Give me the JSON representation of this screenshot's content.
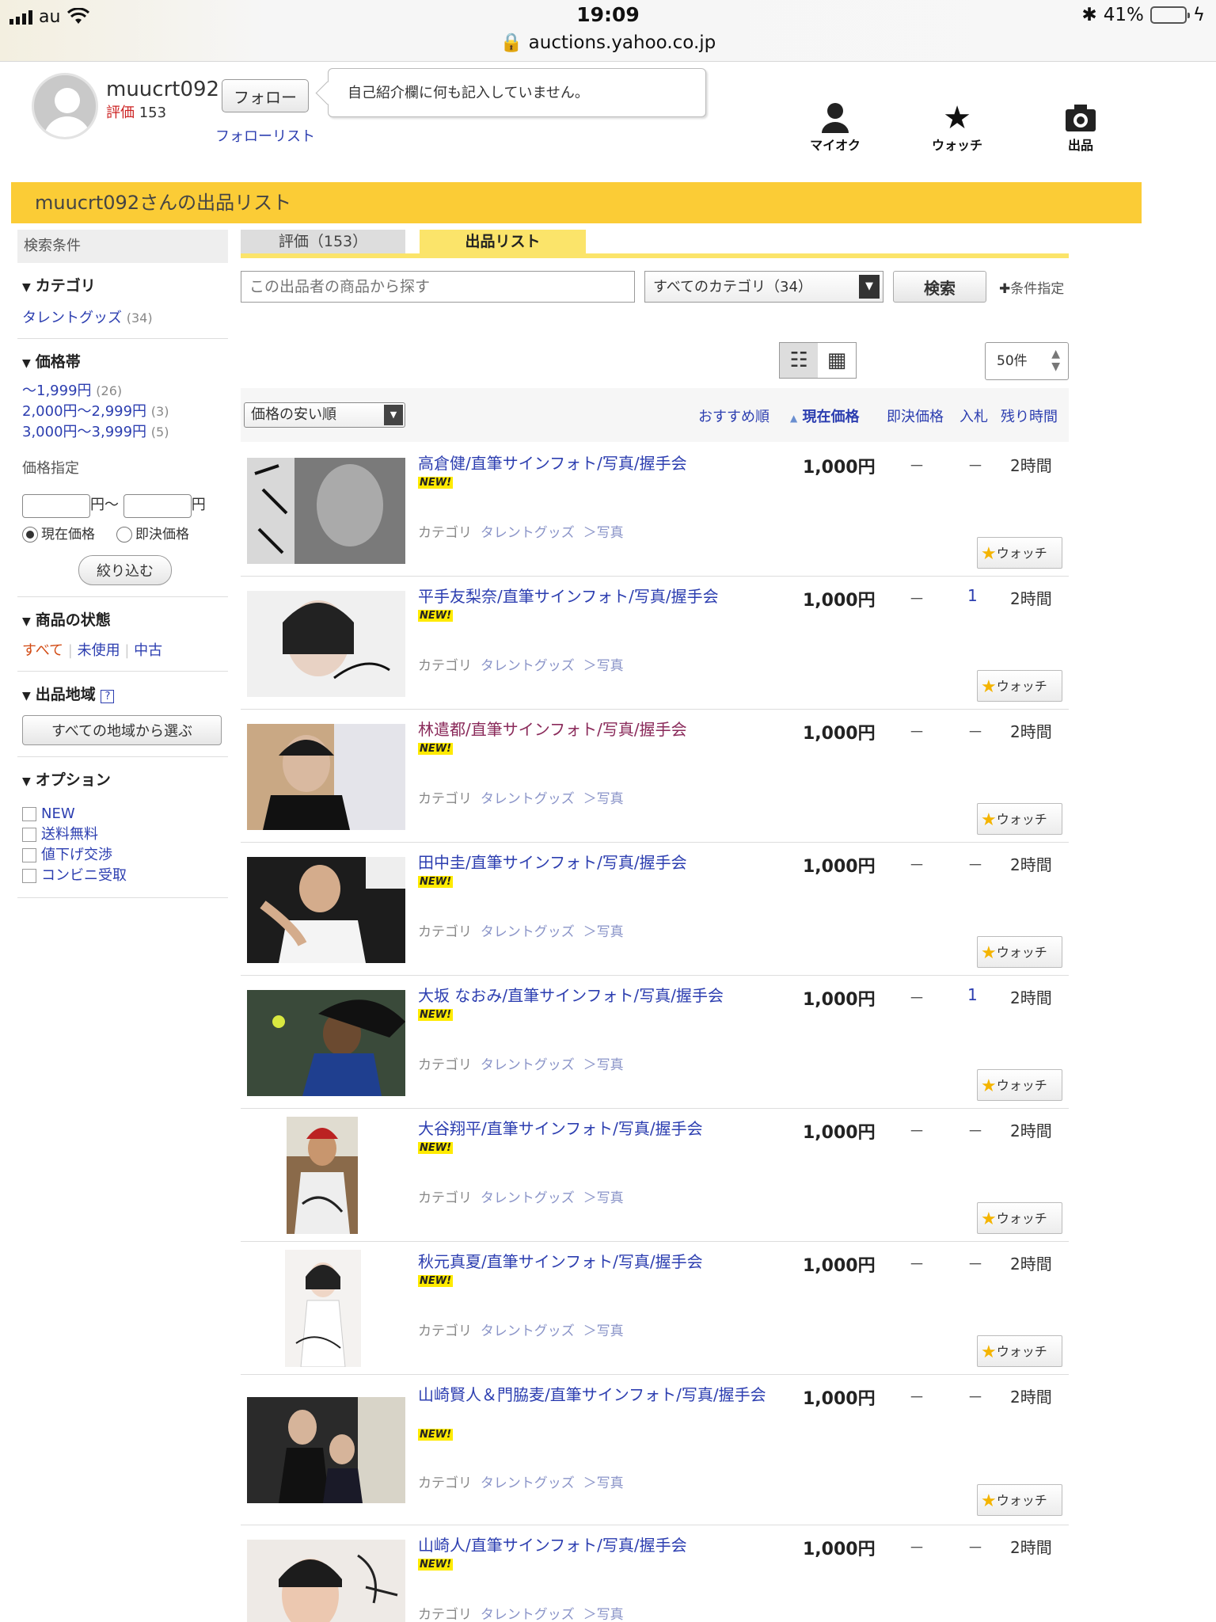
{
  "status": {
    "carrier": "au",
    "time": "19:09",
    "url": "auctions.yahoo.co.jp",
    "battery": "41%",
    "battery_level": 0.41
  },
  "profile": {
    "username": "muucrt092",
    "rating_label": "評価",
    "rating_value": "153",
    "follow_button": "フォロー",
    "follow_list": "フォローリスト",
    "intro": "自己紹介欄に何も記入していません。"
  },
  "topnav": {
    "myauc": "マイオク",
    "watch": "ウォッチ",
    "sell": "出品"
  },
  "page_title": "muucrt092さんの出品リスト",
  "sidebar": {
    "conditions": "検索条件",
    "category_head": "カテゴリ",
    "category_item": "タレントグッズ",
    "category_count": "(34)",
    "price_head": "価格帯",
    "price_ranges": [
      {
        "label": "～1,999円",
        "count": "(26)"
      },
      {
        "label": "2,000円～2,999円",
        "count": "(3)"
      },
      {
        "label": "3,000円～3,999円",
        "count": "(5)"
      }
    ],
    "price_spec": "価格指定",
    "yen_from": "円～",
    "yen_to": "円",
    "radio_current": "現在価格",
    "radio_buynow": "即決価格",
    "narrow_button": "絞り込む",
    "condition_head": "商品の状態",
    "cond_all": "すべて",
    "cond_unused": "未使用",
    "cond_used": "中古",
    "region_head": "出品地域",
    "region_button": "すべての地域から選ぶ",
    "option_head": "オプション",
    "options": [
      "NEW",
      "送料無料",
      "値下げ交渉",
      "コンビニ受取"
    ]
  },
  "tabs": {
    "eval": "評価（153）",
    "list": "出品リスト"
  },
  "search": {
    "placeholder": "この出品者の商品から探す",
    "category": "すべてのカテゴリ（34）",
    "button": "検索",
    "cond_link": "条件指定"
  },
  "perpage": "50件",
  "sort": {
    "select": "価格の安い順",
    "recommend": "おすすめ順",
    "current_price": "現在価格",
    "buynow": "即決価格",
    "bids": "入札",
    "remaining": "残り時間"
  },
  "item_common": {
    "new_badge": "NEW!",
    "category_label": "カテゴリ",
    "category_path": "タレントグッズ",
    "sub_category": "＞写真",
    "watch_label": "ウォッチ",
    "dash": "－"
  },
  "items": [
    {
      "title": "高倉健/直筆サインフォト/写真/握手会",
      "price": "1,000円",
      "bids": "－",
      "time": "2時間"
    },
    {
      "title": "平手友梨奈/直筆サインフォト/写真/握手会",
      "price": "1,000円",
      "bids": "1",
      "time": "2時間"
    },
    {
      "title": "林遣都/直筆サインフォト/写真/握手会",
      "price": "1,000円",
      "bids": "－",
      "time": "2時間"
    },
    {
      "title": "田中圭/直筆サインフォト/写真/握手会",
      "price": "1,000円",
      "bids": "－",
      "time": "2時間"
    },
    {
      "title": "大坂 なおみ/直筆サインフォト/写真/握手会",
      "price": "1,000円",
      "bids": "1",
      "time": "2時間"
    },
    {
      "title": "大谷翔平/直筆サインフォト/写真/握手会",
      "price": "1,000円",
      "bids": "－",
      "time": "2時間"
    },
    {
      "title": "秋元真夏/直筆サインフォト/写真/握手会",
      "price": "1,000円",
      "bids": "－",
      "time": "2時間"
    },
    {
      "title": "山崎賢人＆門脇麦/直筆サインフォト/写真/握手会",
      "price": "1,000円",
      "bids": "－",
      "time": "2時間"
    },
    {
      "title": "山崎人/直筆サインフォト/写真/握手会",
      "price": "1,000円",
      "bids": "－",
      "time": "2時間"
    }
  ]
}
